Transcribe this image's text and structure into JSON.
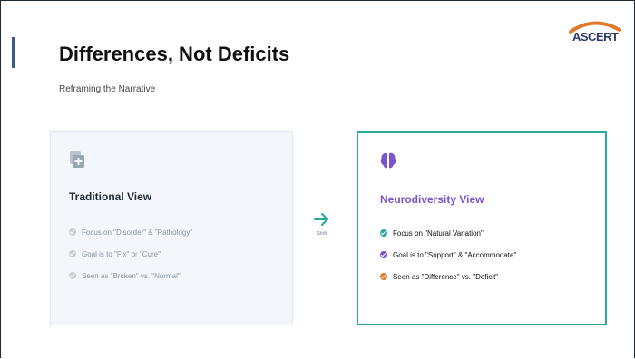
{
  "slide": {
    "title": "Differences, Not Deficits",
    "subtitle": "Reframing the Narrative",
    "logo_text": "ASCERT"
  },
  "traditional": {
    "title": "Traditional View",
    "icon": "medical-plus-icon",
    "items": [
      "Focus on \"Disorder\" & \"Pathology\"",
      "Goal is to \"Fix\" or \"Cure\"",
      "Seen as \"Broken\" vs. \"Normal\""
    ],
    "bullet_color": "#c9ced6"
  },
  "neurodiversity": {
    "title": "Neurodiversity View",
    "icon": "brain-icon",
    "items": [
      "Focus on \"Natural Variation\"",
      "Goal is to \"Support\" & \"Accommodate\"",
      "Seen as \"Difference\" vs. \"Deficit\""
    ],
    "bullet_colors": [
      "#2aa8a0",
      "#7b54c9",
      "#e07a2c"
    ]
  },
  "shift": {
    "label": "Shift",
    "icon": "arrow-right-icon"
  },
  "colors": {
    "accent_teal": "#2aa8a0",
    "accent_purple": "#7b54c9",
    "accent_orange": "#e07a2c"
  }
}
